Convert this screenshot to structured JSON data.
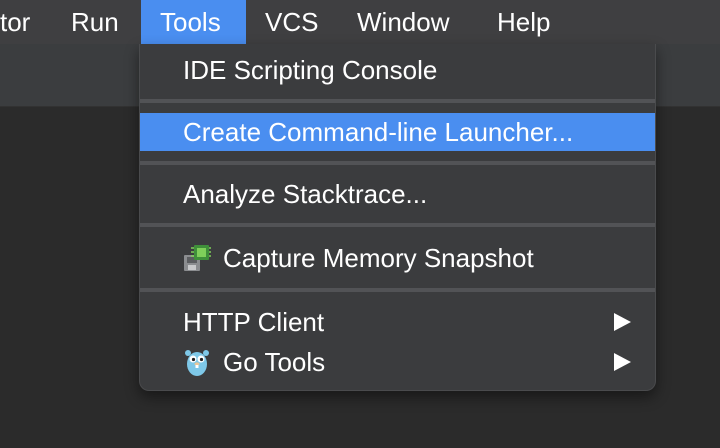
{
  "menubar": {
    "items": [
      {
        "label": "tor"
      },
      {
        "label": "Run"
      },
      {
        "label": "Tools",
        "active": true
      },
      {
        "label": "VCS"
      },
      {
        "label": "Window"
      },
      {
        "label": "Help"
      }
    ]
  },
  "tools_menu": {
    "items": [
      {
        "label": "IDE Scripting Console"
      },
      {
        "label": "Create Command-line Launcher...",
        "highlighted": true
      },
      {
        "label": "Analyze Stacktrace..."
      },
      {
        "label": "Capture Memory Snapshot",
        "icon": "memory-snapshot-icon"
      },
      {
        "label": "HTTP Client",
        "submenu": true
      },
      {
        "label": "Go Tools",
        "icon": "gopher-icon",
        "submenu": true
      }
    ]
  },
  "colors": {
    "accent": "#4a8ef0",
    "menu_bg": "#3b3c3e",
    "menubar_bg": "#3f3f41",
    "editor_bg": "#2b2b2b"
  }
}
